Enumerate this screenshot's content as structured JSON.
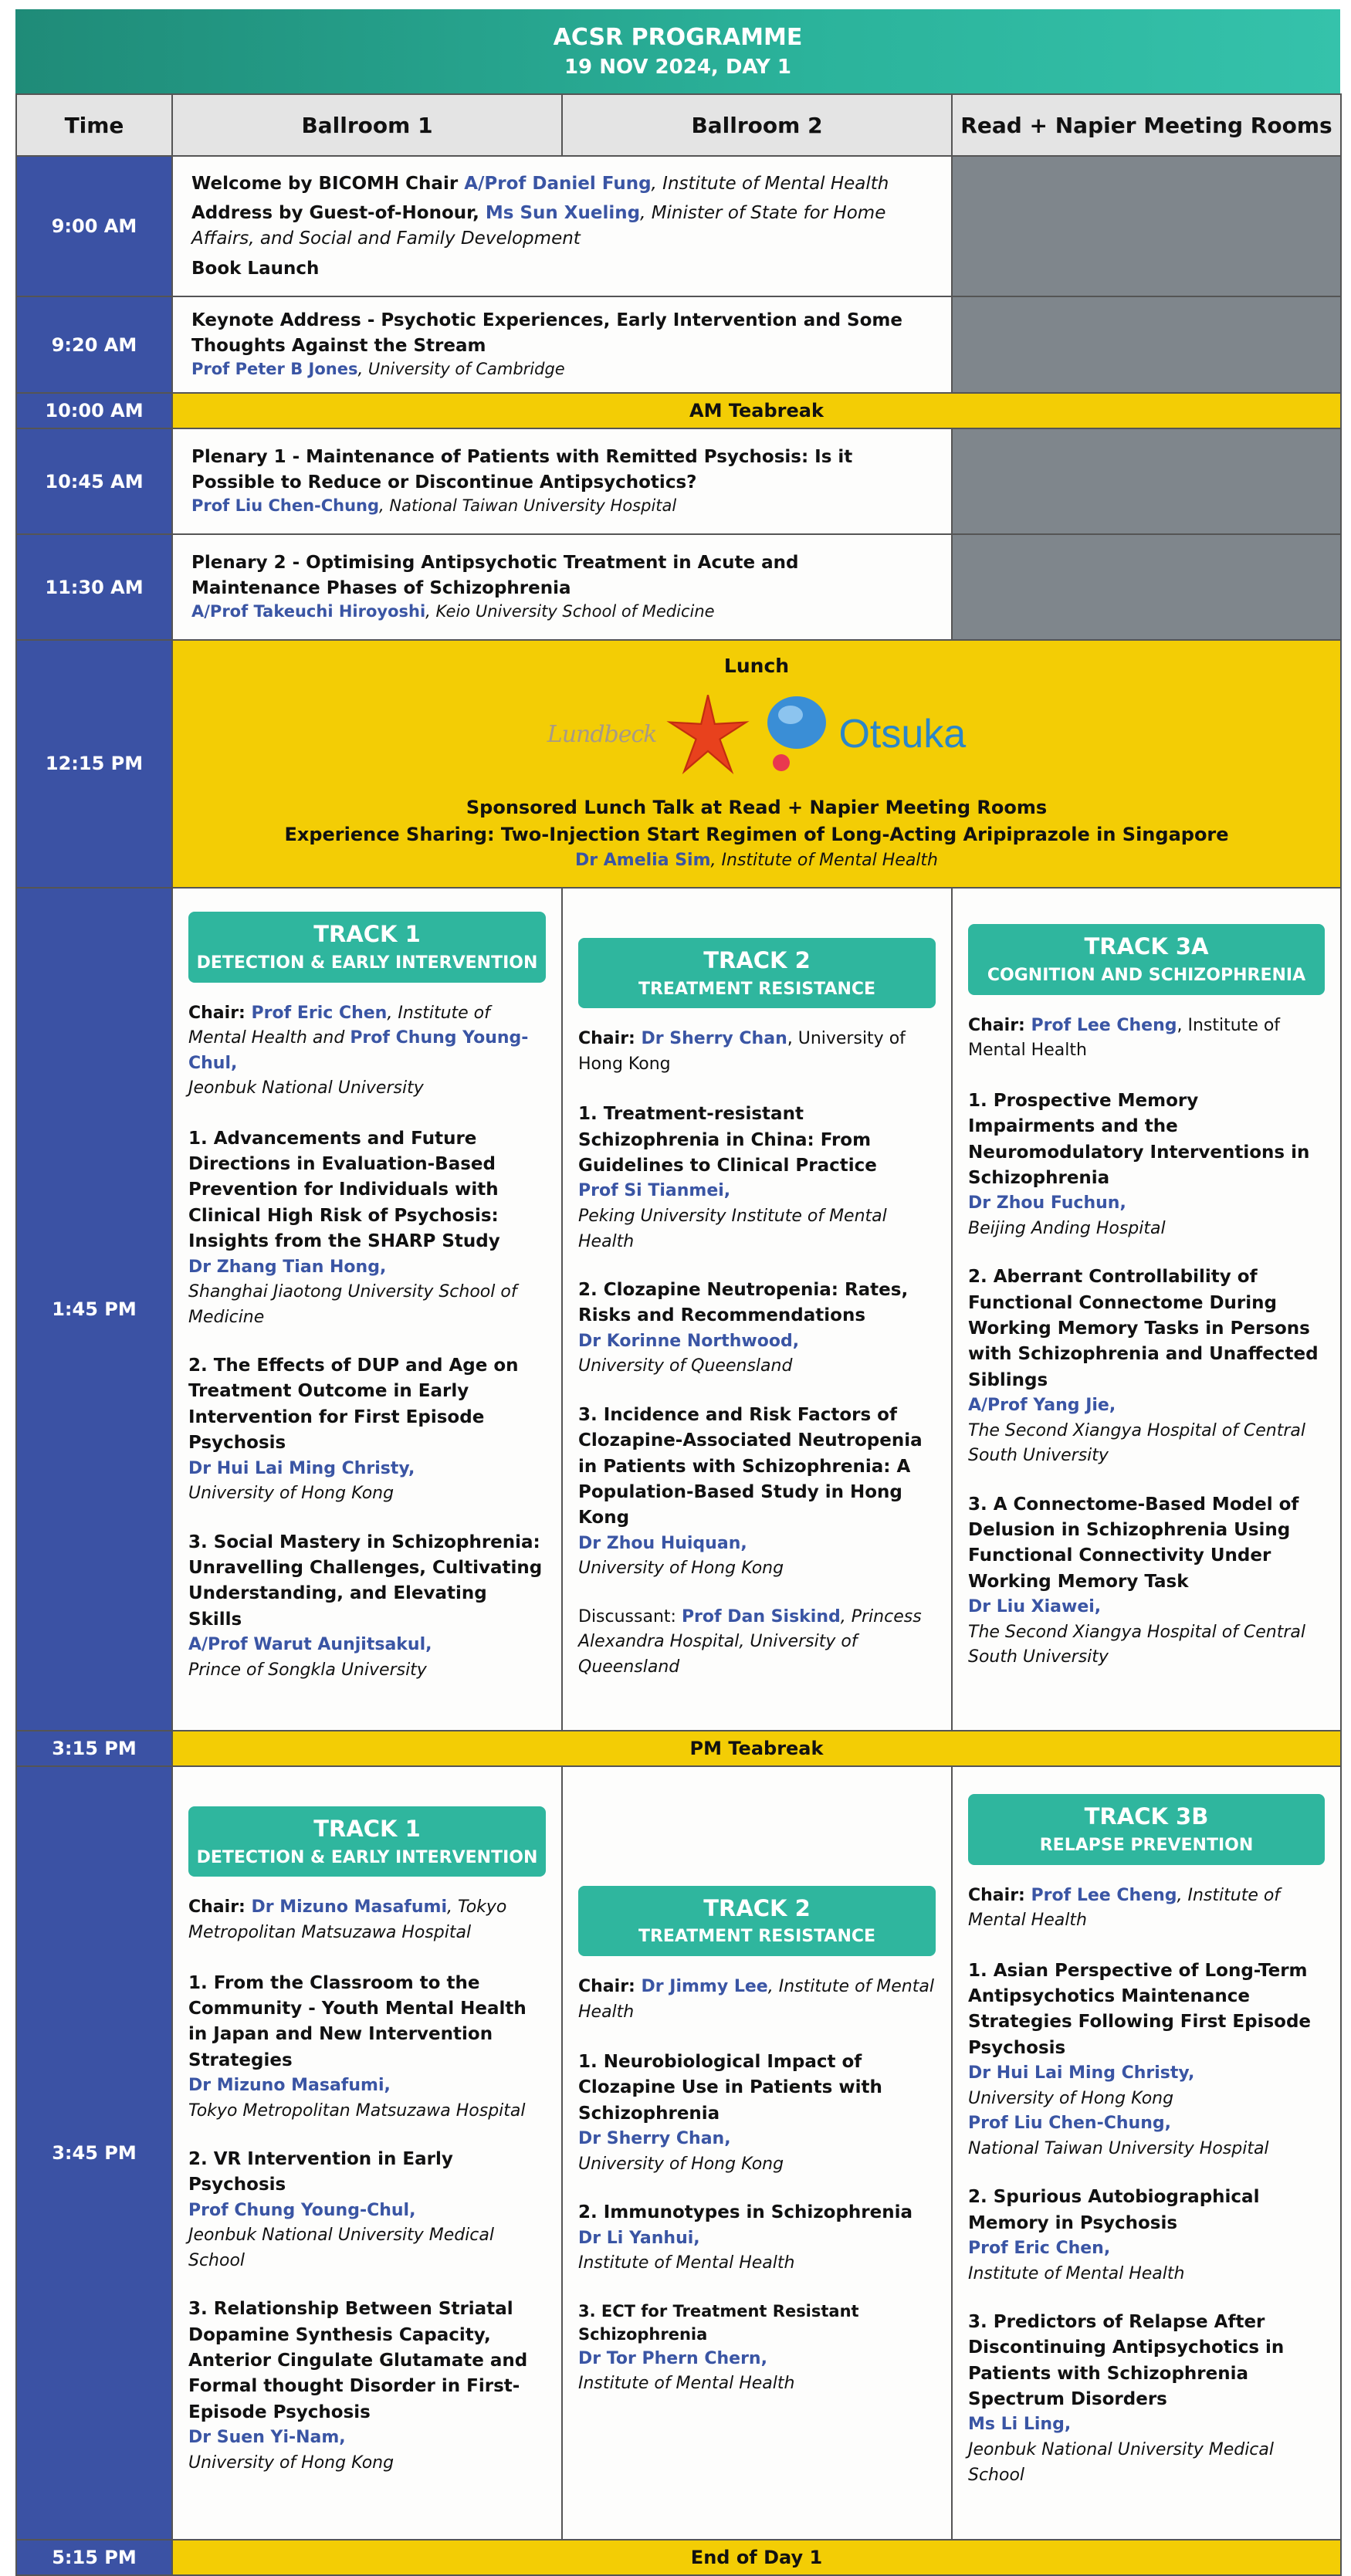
{
  "header": {
    "title": "ACSR PROGRAMME",
    "subtitle": "19 NOV 2024, DAY 1"
  },
  "columns": {
    "time": "Time",
    "room1": "Ballroom  1",
    "room2": "Ballroom  2",
    "room3": "Read + Napier Meeting Rooms"
  },
  "s900": {
    "time": "9:00 AM",
    "welcome_pre": "Welcome by BICOMH Chair ",
    "welcome_name": "A/Prof Daniel Fung",
    "welcome_aff": ", Institute of Mental Health",
    "address_pre": "Address by Guest-of-Honour, ",
    "address_name": "Ms Sun Xueling",
    "address_aff": ", Minister of State for Home Affairs, and Social and Family Development",
    "book": "Book Launch"
  },
  "s920": {
    "time": "9:20 AM",
    "title": "Keynote Address - Psychotic Experiences, Early Intervention and Some Thoughts Against the Stream",
    "speaker": "Prof Peter B Jones",
    "aff": ", University of Cambridge"
  },
  "am_tea": {
    "time": "10:00 AM",
    "label": "AM Teabreak"
  },
  "s1045": {
    "time": "10:45 AM",
    "title": "Plenary 1 - Maintenance of Patients with Remitted Psychosis: Is it Possible to Reduce or Discontinue Antipsychotics?",
    "speaker": "Prof Liu Chen-Chung",
    "aff": ", National Taiwan University Hospital"
  },
  "s1130": {
    "time": "11:30 AM",
    "title": "Plenary 2 - Optimising Antipsychotic Treatment in Acute and Maintenance Phases of Schizophrenia",
    "speaker": "A/Prof Takeuchi Hiroyoshi",
    "aff": ", Keio University School of Medicine"
  },
  "lunch": {
    "time": "12:15 PM",
    "title": "Lunch",
    "logo1": "Lundbeck",
    "logo2": "Otsuka",
    "line1": "Sponsored Lunch Talk at Read + Napier Meeting Rooms",
    "line2": "Experience Sharing: Two-Injection Start Regimen of Long-Acting Aripiprazole in Singapore",
    "speaker": "Dr Amelia Sim",
    "aff": ", Institute of Mental Health"
  },
  "block1": {
    "time": "1:45 PM",
    "t1": {
      "num": "TRACK 1",
      "name": "DETECTION & EARLY INTERVENTION",
      "chair_label": "Chair: ",
      "chair1": "Prof Eric Chen",
      "chair1_aff": ", Institute of Mental Health",
      "chair_and": " and ",
      "chair2": "Prof Chung Young-Chul,",
      "chair2_aff": "Jeonbuk National University",
      "talks": [
        {
          "title": "1. Advancements and Future Directions in Evaluation-Based Prevention for Individuals with Clinical High Risk of Psychosis: Insights from the SHARP Study",
          "speaker": "Dr Zhang Tian Hong,",
          "aff": "Shanghai Jiaotong University School of Medicine"
        },
        {
          "title": "2. The Effects of DUP and Age on Treatment Outcome in Early Intervention for First Episode Psychosis",
          "speaker": "Dr Hui Lai Ming Christy,",
          "aff": "University of Hong Kong"
        },
        {
          "title": "3. Social Mastery in Schizophrenia: Unravelling Challenges, Cultivating Understanding, and Elevating Skills",
          "speaker": "A/Prof Warut Aunjitsakul,",
          "aff": "Prince of Songkla University"
        }
      ]
    },
    "t2": {
      "num": "TRACK 2",
      "name": "TREATMENT RESISTANCE",
      "chair_label": "Chair: ",
      "chair1": "Dr Sherry Chan",
      "chair1_aff": ", University of Hong Kong",
      "talks": [
        {
          "title": "1. Treatment-resistant Schizophrenia in China: From Guidelines to Clinical Practice",
          "speaker": "Prof Si Tianmei,",
          "aff": "Peking University Institute of Mental Health"
        },
        {
          "title": "2. Clozapine Neutropenia: Rates, Risks and Recommendations",
          "speaker": "Dr Korinne Northwood,",
          "aff": "University of Queensland"
        },
        {
          "title": "3. Incidence and Risk Factors of Clozapine-Associated Neutropenia in Patients with Schizophrenia: A Population-Based Study in Hong Kong",
          "speaker": "Dr Zhou Huiquan,",
          "aff": "University of Hong Kong"
        }
      ],
      "disc_label": "Discussant: ",
      "disc_name": "Prof Dan Siskind",
      "disc_aff": ", Princess Alexandra Hospital, University of Queensland"
    },
    "t3": {
      "num": "TRACK 3A",
      "name": "COGNITION AND SCHIZOPHRENIA",
      "chair_label": "Chair: ",
      "chair1": "Prof Lee Cheng",
      "chair1_aff": ", Institute of Mental Health",
      "talks": [
        {
          "title": "1. Prospective Memory Impairments and the Neuromodulatory Interventions in Schizophrenia",
          "speaker": "Dr Zhou Fuchun,",
          "aff": "Beijing Anding Hospital"
        },
        {
          "title": "2. Aberrant Controllability of Functional Connectome During Working Memory Tasks in Persons with Schizophrenia and Unaffected Siblings",
          "speaker": "A/Prof Yang Jie,",
          "aff": "The Second Xiangya Hospital of Central South University"
        },
        {
          "title": "3. A Connectome-Based Model of Delusion in Schizophrenia Using Functional Connectivity Under Working Memory Task",
          "speaker": "Dr Liu Xiawei,",
          "aff": "The Second Xiangya Hospital of Central South University"
        }
      ]
    }
  },
  "pm_tea": {
    "time": "3:15 PM",
    "label": "PM Teabreak"
  },
  "block2": {
    "time": "3:45 PM",
    "t1": {
      "num": "TRACK 1",
      "name": "DETECTION & EARLY INTERVENTION",
      "chair_label": "Chair: ",
      "chair1": "Dr Mizuno Masafumi",
      "chair1_aff": ", Tokyo Metropolitan Matsuzawa Hospital",
      "talks": [
        {
          "title": "1. From the Classroom to the Community - Youth Mental Health in Japan and New Intervention Strategies",
          "speaker": "Dr Mizuno Masafumi,",
          "aff": "Tokyo Metropolitan Matsuzawa Hospital"
        },
        {
          "title": "2. VR Intervention in Early Psychosis",
          "speaker": "Prof Chung Young-Chul,",
          "aff": "Jeonbuk National University Medical School"
        },
        {
          "title": "3. Relationship Between Striatal Dopamine Synthesis Capacity, Anterior Cingulate Glutamate and Formal thought Disorder in First-Episode Psychosis",
          "speaker": "Dr Suen Yi-Nam,",
          "aff": "University of Hong Kong"
        }
      ]
    },
    "t2": {
      "num": "TRACK 2",
      "name": "TREATMENT RESISTANCE",
      "chair_label": "Chair: ",
      "chair1": "Dr Jimmy Lee",
      "chair1_aff": ", Institute of Mental Health",
      "talks": [
        {
          "title": "1. Neurobiological Impact of Clozapine Use in Patients with Schizophrenia",
          "speaker": "Dr Sherry Chan,",
          "aff": "University of Hong Kong"
        },
        {
          "title": "2. Immunotypes in Schizophrenia",
          "speaker": "Dr Li Yanhui,",
          "aff": "Institute of Mental Health"
        },
        {
          "title": "3. ECT for Treatment Resistant Schizophrenia",
          "speaker": "Dr Tor Phern Chern,",
          "aff": "Institute of Mental Health"
        }
      ]
    },
    "t3": {
      "num": "TRACK 3B",
      "name": "RELAPSE PREVENTION",
      "chair_label": "Chair: ",
      "chair1": "Prof Lee Cheng",
      "chair1_aff": ", Institute of Mental Health",
      "talks": [
        {
          "title": "1. Asian Perspective of Long-Term Antipsychotics Maintenance Strategies Following First Episode Psychosis",
          "speaker": "Dr Hui Lai Ming Christy,",
          "aff": "University of Hong Kong",
          "speaker2": "Prof Liu Chen-Chung,",
          "aff2": "National Taiwan University Hospital"
        },
        {
          "title": "2. Spurious Autobiographical Memory in Psychosis",
          "speaker": "Prof Eric Chen,",
          "aff": "Institute of Mental Health"
        },
        {
          "title": "3. Predictors of Relapse After Discontinuing Antipsychotics in Patients with Schizophrenia Spectrum Disorders",
          "speaker": "Ms Li Ling,",
          "aff": "Jeonbuk National University Medical School"
        }
      ]
    }
  },
  "end": {
    "time": "5:15 PM",
    "label": "End of Day 1"
  },
  "colors": {
    "title_green": "#2bb39b",
    "time_blue": "#3b52a4",
    "teabreak_yellow": "#f3cd05",
    "speaker_blue": "#3a55a4",
    "empty_grey": "#7f868c"
  }
}
